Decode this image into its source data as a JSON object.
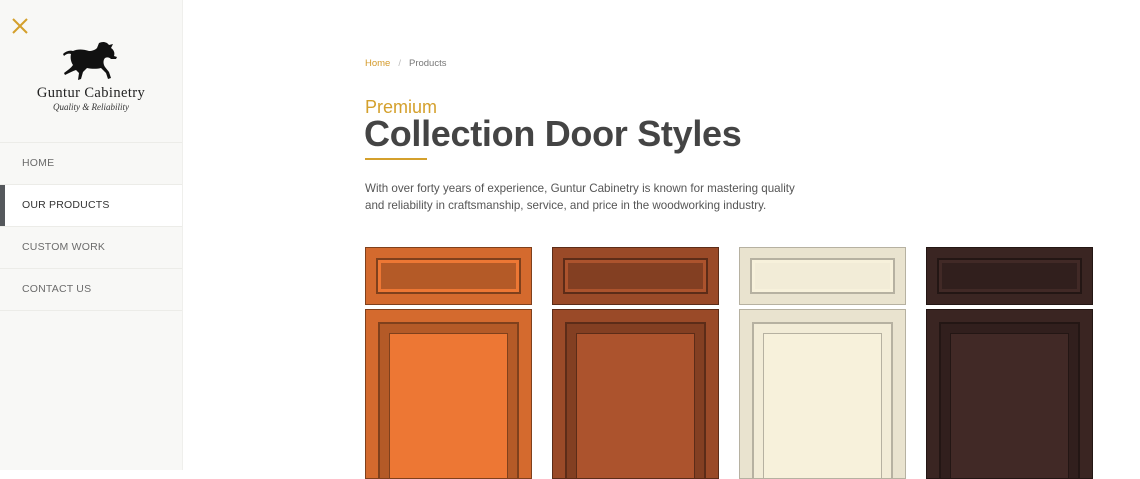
{
  "sidebar": {
    "logo": {
      "name": "Guntur Cabinetry",
      "tagline": "Quality & Reliability"
    },
    "nav": [
      {
        "label": "HOME",
        "active": false
      },
      {
        "label": "OUR PRODUCTS",
        "active": true
      },
      {
        "label": "CUSTOM WORK",
        "active": false
      },
      {
        "label": "CONTACT US",
        "active": false
      }
    ]
  },
  "breadcrumb": {
    "home": "Home",
    "separator": "/",
    "current": "Products"
  },
  "header": {
    "eyebrow": "Premium",
    "title": "Collection Door Styles"
  },
  "intro": "With over forty years of experience, Guntur Cabinetry is known for mastering quality and reliability in craftsmanship, service, and price in the woodworking industry.",
  "doors": [
    {
      "name": "cherry-door",
      "color": "#d46a2e"
    },
    {
      "name": "brown-door",
      "color": "#9a4a28"
    },
    {
      "name": "cream-door",
      "color": "#e9e3cf"
    },
    {
      "name": "espresso-door",
      "color": "#3a2522"
    }
  ],
  "colors": {
    "accent": "#d4a02c",
    "sidebar_bg": "#f8f8f6",
    "active_marker": "#55585c"
  }
}
